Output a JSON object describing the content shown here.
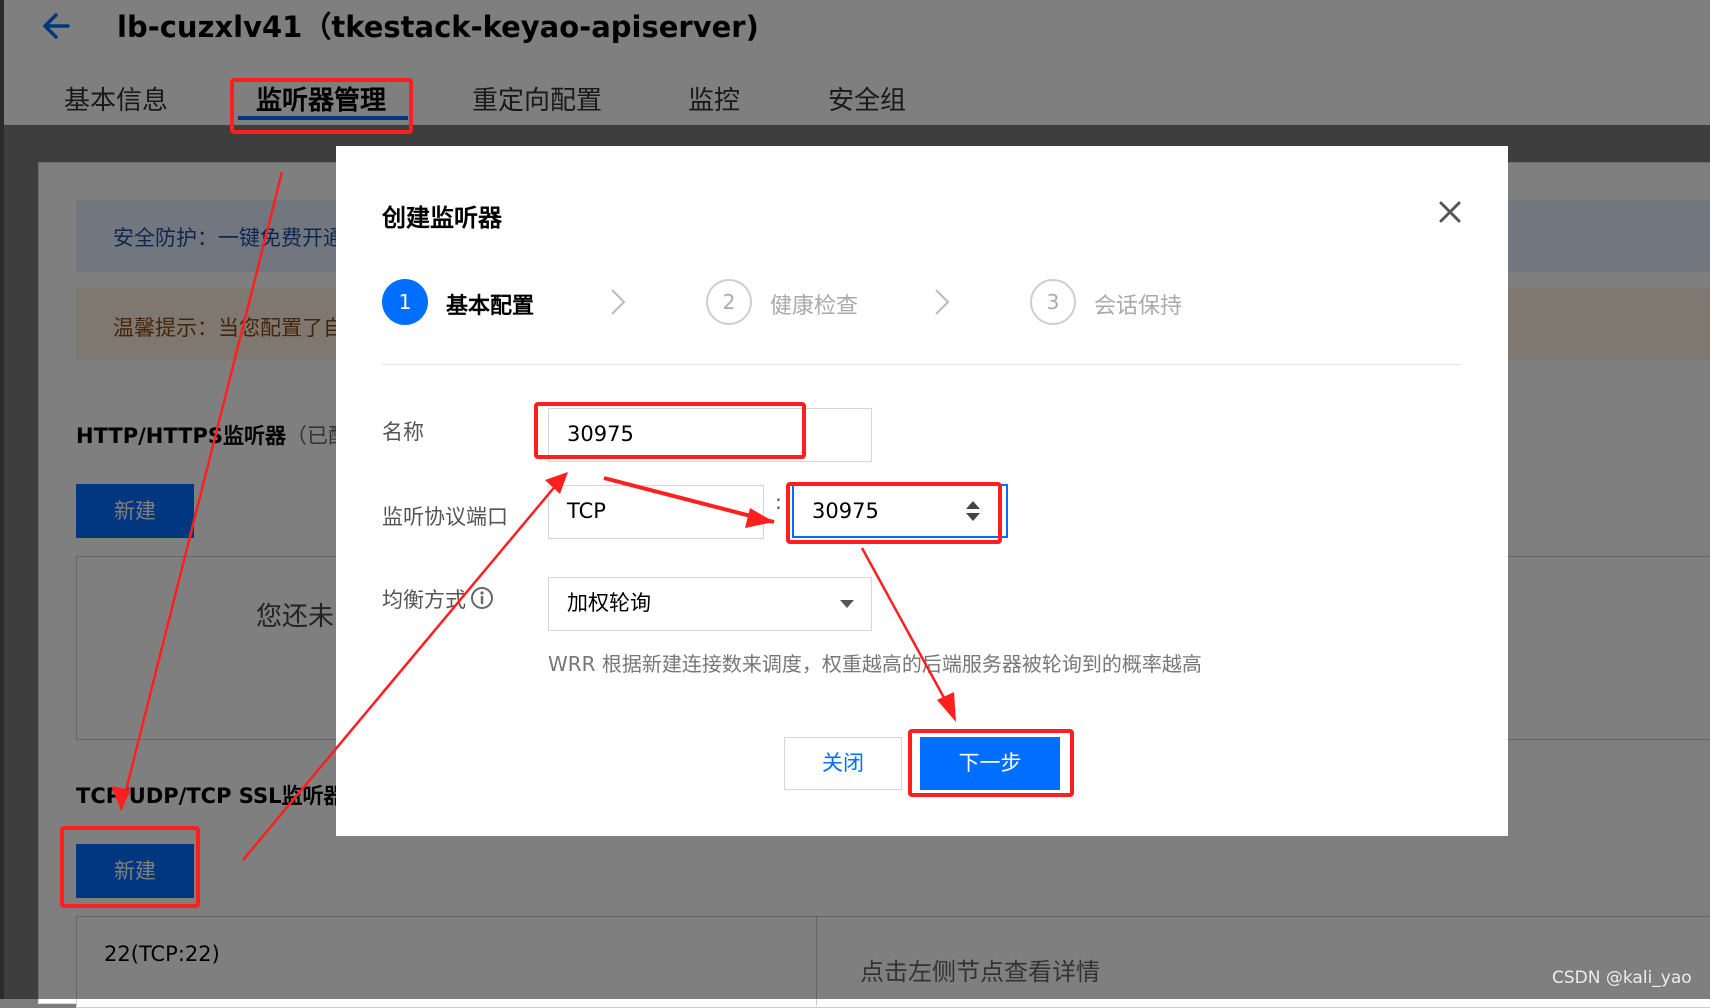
{
  "page": {
    "title": "lb-cuzxlv41（tkestack-keyao-apiserver)",
    "tabs": [
      {
        "label": "基本信息"
      },
      {
        "label": "监听器管理"
      },
      {
        "label": "重定向配置"
      },
      {
        "label": "监控"
      },
      {
        "label": "安全组"
      }
    ],
    "active_tab": "监听器管理",
    "banner_security": "安全防护：一键免费开通",
    "banner_tip": "温馨提示：当您配置了自",
    "http_section": {
      "title": "HTTP/HTTPS监听器",
      "suffix": "（已配",
      "new_button": "新建"
    },
    "empty_text": "您还未",
    "tcp_section": {
      "title": "TCP/UDP/TCP SSL监听器",
      "new_button": "新建"
    },
    "listener_item": "22(TCP:22)",
    "detail_hint": "点击左侧节点查看详情"
  },
  "modal": {
    "title": "创建监听器",
    "steps": [
      {
        "num": "1",
        "label": "基本配置",
        "state": "active"
      },
      {
        "num": "2",
        "label": "健康检查",
        "state": "todo"
      },
      {
        "num": "3",
        "label": "会话保持",
        "state": "todo"
      }
    ],
    "form": {
      "name_label": "名称",
      "name_value": "30975",
      "protocol_port_label": "监听协议端口",
      "protocol_value": "TCP",
      "port_separator": ":",
      "port_value": "30975",
      "balance_label": "均衡方式",
      "balance_value": "加权轮询",
      "balance_help": "WRR 根据新建连接数来调度，权重越高的后端服务器被轮询到的概率越高"
    },
    "buttons": {
      "close": "关闭",
      "next": "下一步"
    }
  },
  "watermark": "CSDN @kali_yao",
  "colors": {
    "primary": "#006eff",
    "annotation": "#ff1f1f"
  }
}
